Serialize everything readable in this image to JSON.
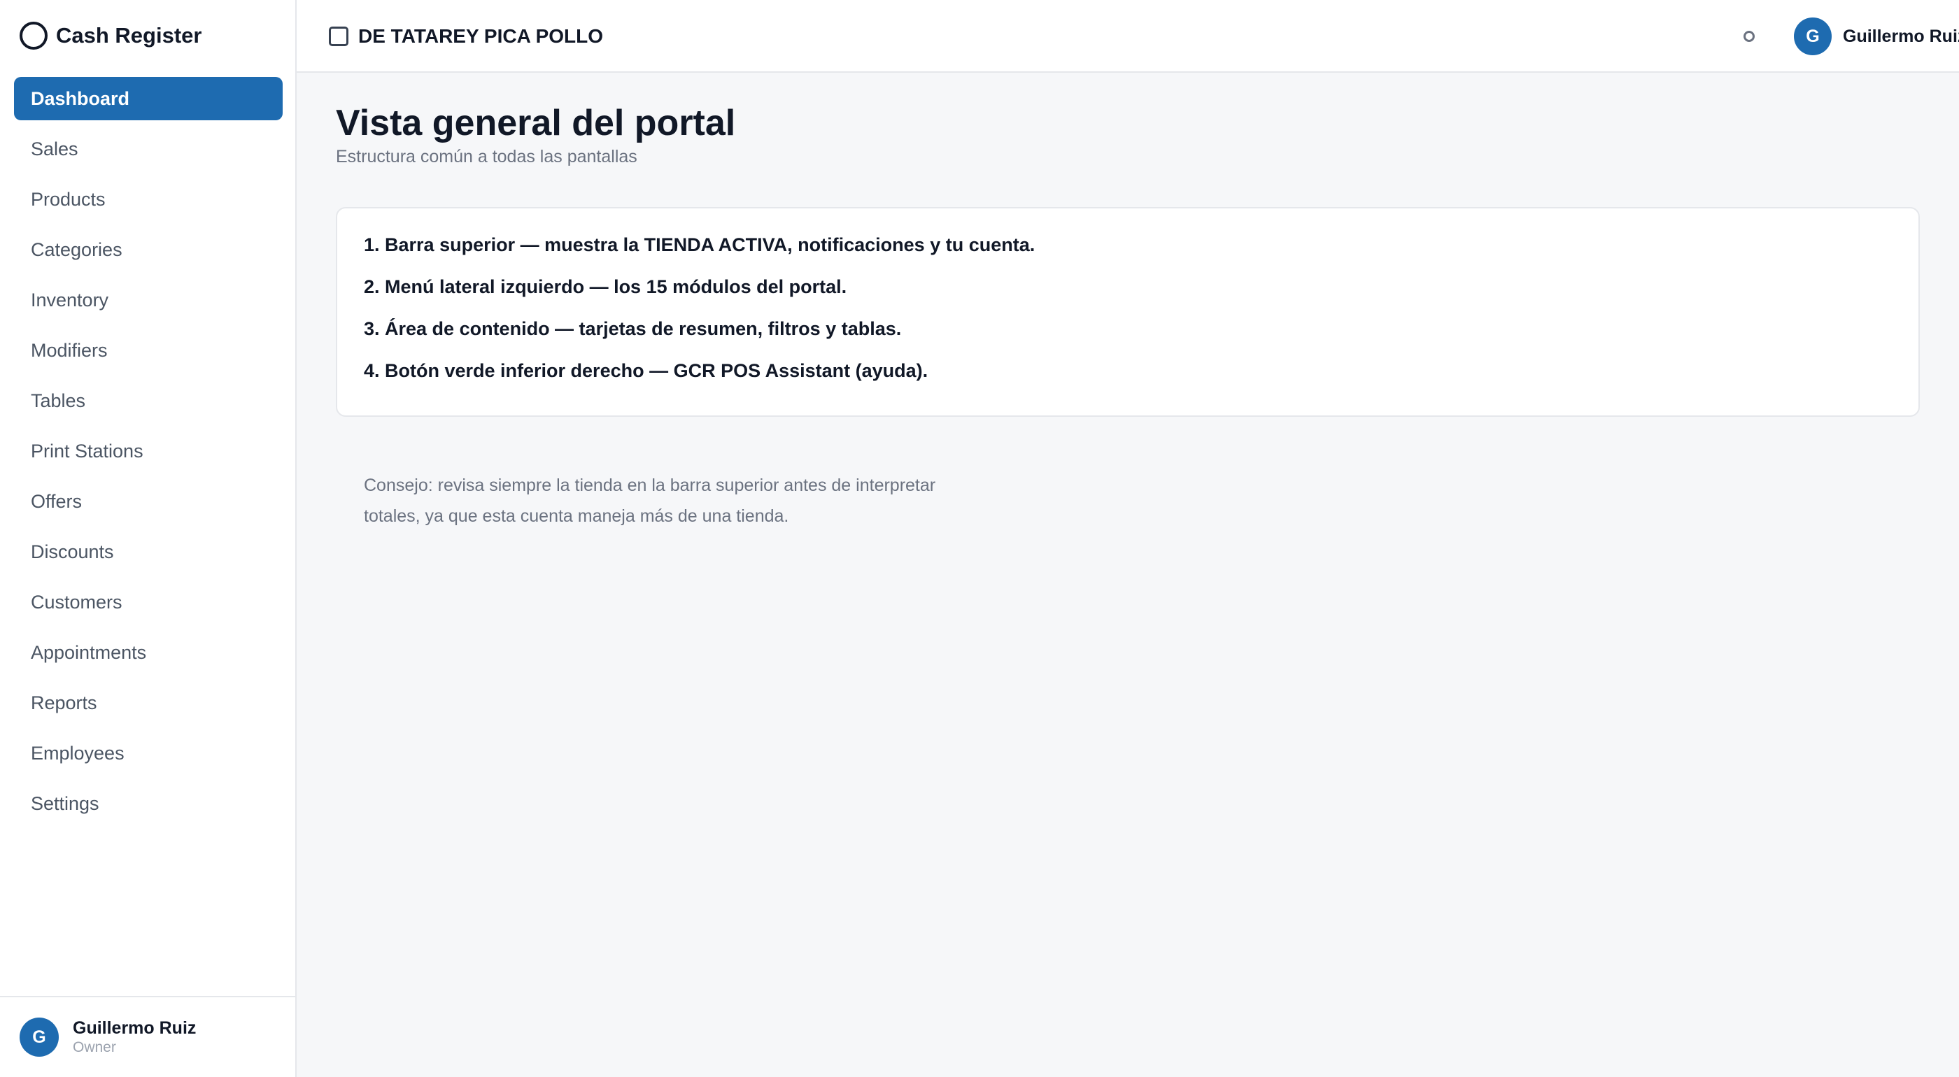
{
  "sidebar": {
    "brand": "Cash Register",
    "items": [
      {
        "label": "Dashboard",
        "active": true
      },
      {
        "label": "Sales"
      },
      {
        "label": "Products"
      },
      {
        "label": "Categories"
      },
      {
        "label": "Inventory"
      },
      {
        "label": "Modifiers"
      },
      {
        "label": "Tables"
      },
      {
        "label": "Print Stations"
      },
      {
        "label": "Offers"
      },
      {
        "label": "Discounts"
      },
      {
        "label": "Customers"
      },
      {
        "label": "Appointments"
      },
      {
        "label": "Reports"
      },
      {
        "label": "Employees"
      },
      {
        "label": "Settings"
      }
    ],
    "user": {
      "initial": "G",
      "name": "Guillermo Ruiz",
      "role": "Owner"
    }
  },
  "topbar": {
    "store_name": "DE TATAREY PICA POLLO",
    "account": {
      "initial": "G",
      "name": "Guillermo Ruiz"
    }
  },
  "main": {
    "title": "Vista general del portal",
    "subtitle": "Estructura común a todas las pantallas",
    "steps": [
      "1. Barra superior — muestra la TIENDA ACTIVA, notificaciones y tu cuenta.",
      "2. Menú lateral izquierdo — los 15 módulos del portal.",
      "3. Área de contenido — tarjetas de resumen, filtros y tablas.",
      "4. Botón verde inferior derecho — GCR POS Assistant (ayuda)."
    ],
    "tip": "Consejo: revisa siempre la tienda en la barra superior antes de interpretar totales, ya que esta cuenta maneja más de una tienda."
  },
  "colors": {
    "accent": "#1e6bb0",
    "background": "#f6f7f9"
  }
}
